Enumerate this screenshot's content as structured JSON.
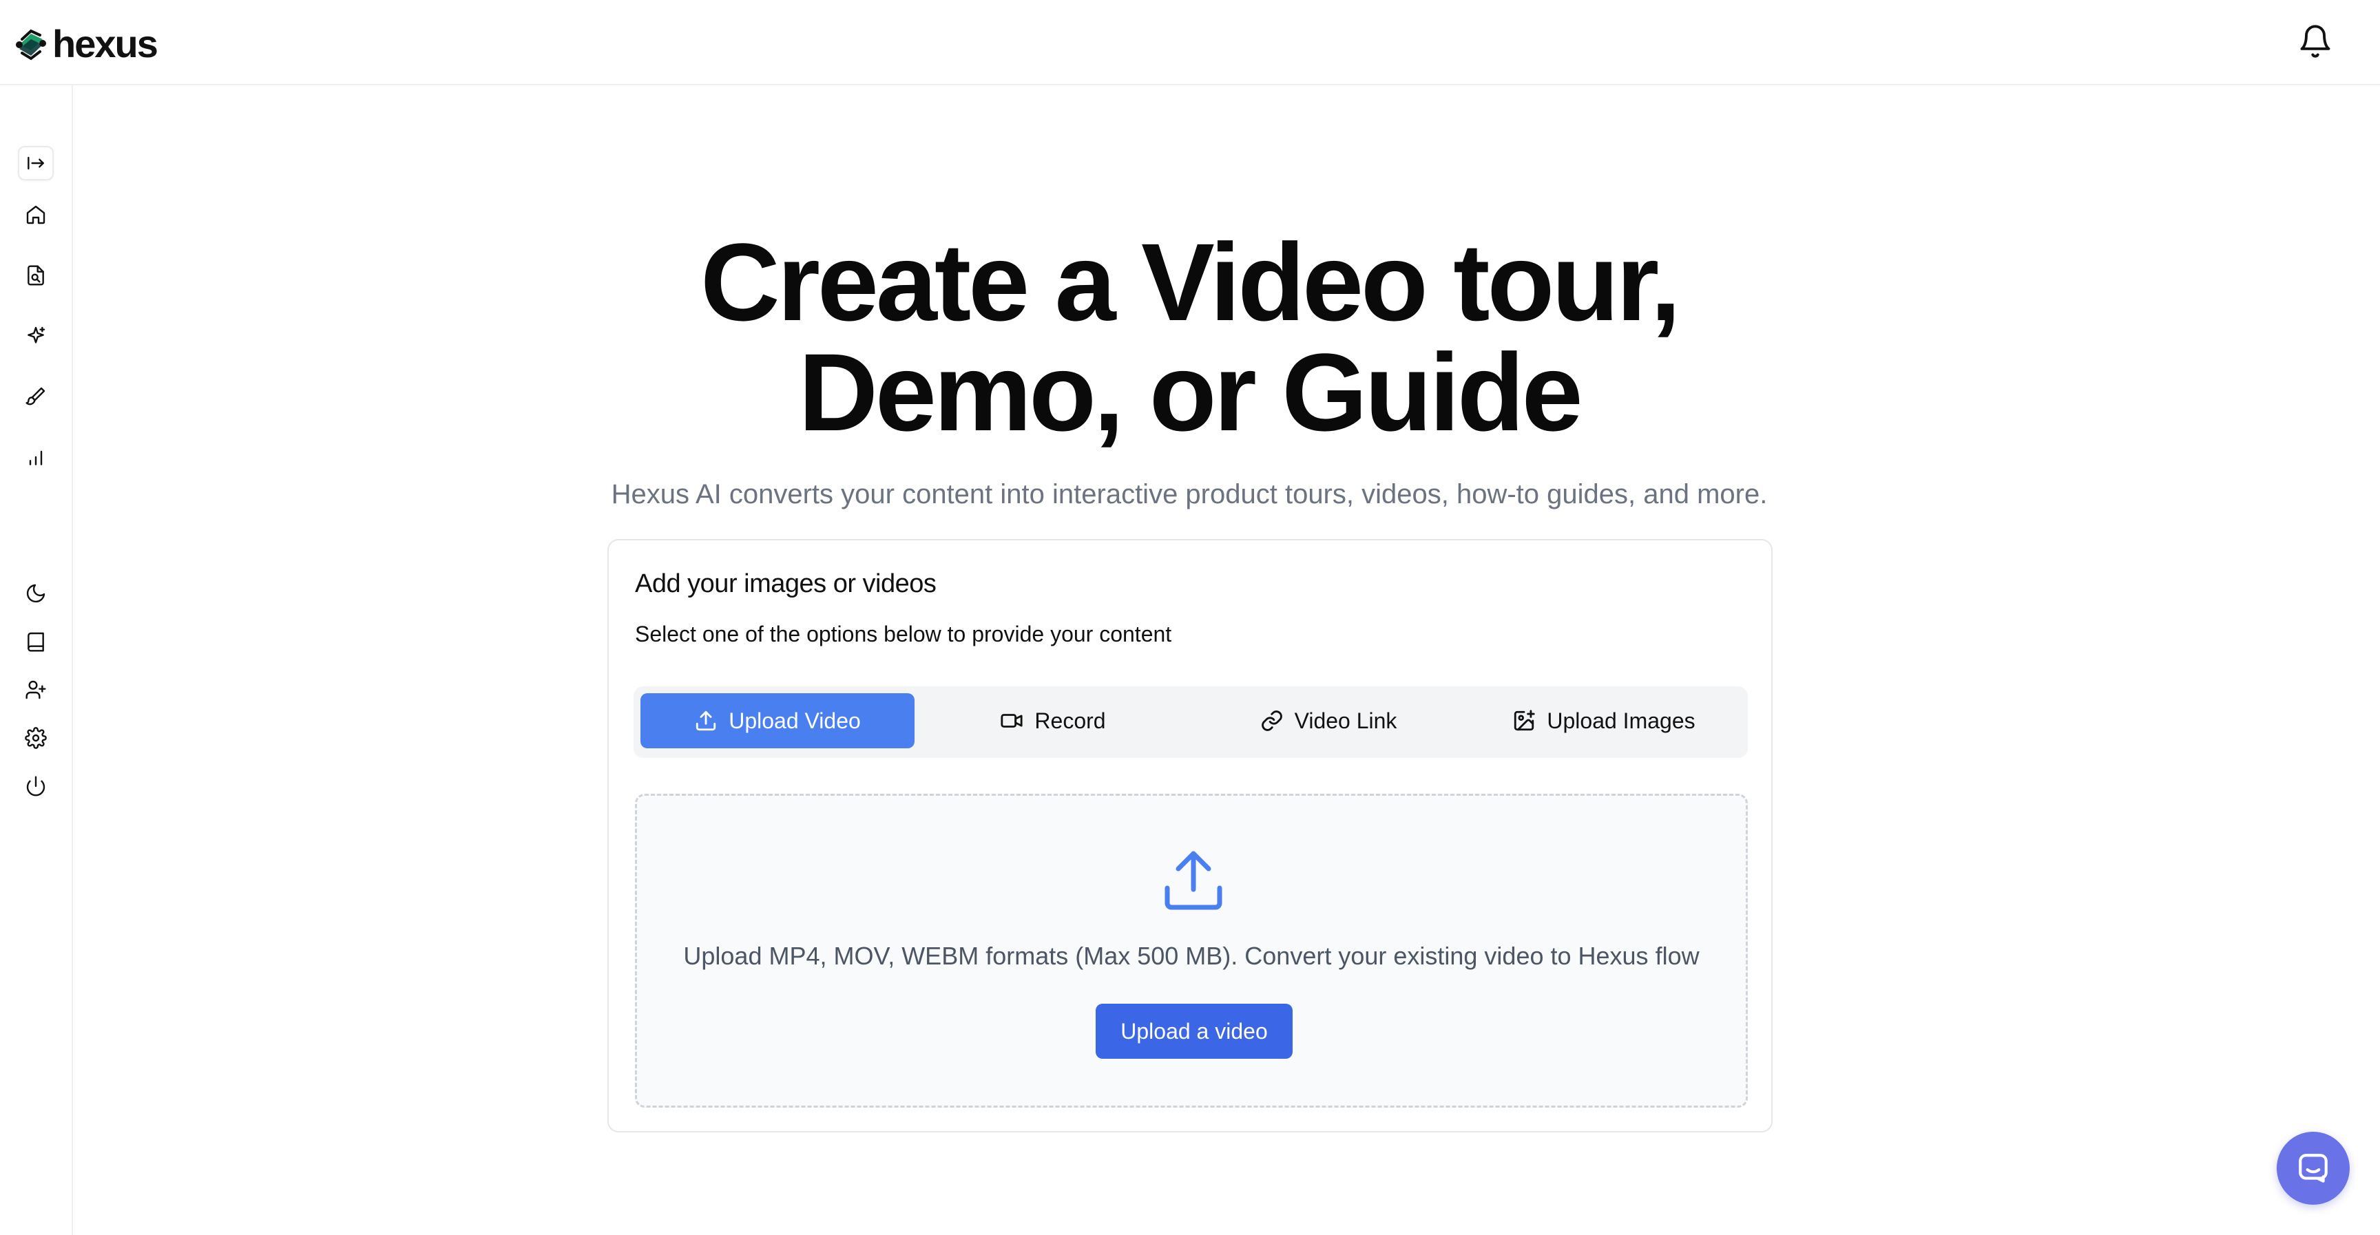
{
  "brand": {
    "name": "hexus"
  },
  "header": {
    "notifications_icon": "bell-icon"
  },
  "sidebar": {
    "toggle_icon": "expand-sidebar-icon",
    "items": [
      {
        "icon": "home-icon"
      },
      {
        "icon": "file-search-icon"
      },
      {
        "icon": "sparkles-icon"
      },
      {
        "icon": "paintbrush-icon"
      },
      {
        "icon": "bar-chart-icon"
      },
      {
        "icon": "moon-icon"
      },
      {
        "icon": "book-icon"
      },
      {
        "icon": "user-plus-icon"
      },
      {
        "icon": "settings-icon"
      },
      {
        "icon": "power-icon"
      }
    ]
  },
  "hero": {
    "title_line1": "Create a Video tour,",
    "title_line2": "Demo, or Guide",
    "subtitle": "Hexus AI converts your content into interactive product tours, videos, how-to guides, and more."
  },
  "card": {
    "title": "Add your images or videos",
    "description": "Select one of the options below to provide your content",
    "tabs": [
      {
        "label": "Upload Video",
        "icon": "upload-icon",
        "active": true
      },
      {
        "label": "Record",
        "icon": "video-camera-icon",
        "active": false
      },
      {
        "label": "Video Link",
        "icon": "link-icon",
        "active": false
      },
      {
        "label": "Upload Images",
        "icon": "image-plus-icon",
        "active": false
      }
    ],
    "dropzone": {
      "icon": "upload-arrow-icon",
      "text": "Upload MP4, MOV, WEBM formats (Max 500 MB). Convert your existing video to Hexus flow",
      "button_label": "Upload a video"
    }
  },
  "colors": {
    "accent": "#4a7ff0",
    "button_primary": "#3b66e6",
    "chat_bubble": "#6a72e8",
    "subtitle_gray": "#6b7280"
  },
  "chat": {
    "icon": "chat-icon"
  }
}
